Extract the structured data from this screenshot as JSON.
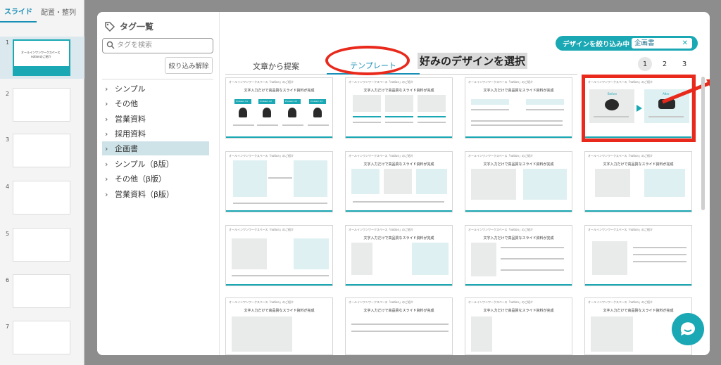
{
  "sidebar_tabs": {
    "slide": "スライド",
    "layout": "配置・整列"
  },
  "slides": [
    "1",
    "2",
    "3",
    "4",
    "5",
    "6",
    "7"
  ],
  "thumb1": {
    "line1": "オールインワンワークスペース",
    "line2": "notionのご紹介"
  },
  "taglist": {
    "title": "タグ一覧",
    "search_placeholder": "タグを検索",
    "filter_clear": "絞り込み解除",
    "categories": [
      "シンプル",
      "その他",
      "営業資料",
      "採用資料",
      "企画書",
      "シンプル（β版）",
      "その他（β版）",
      "営業資料（β版）"
    ]
  },
  "tabs": {
    "from_text": "文章から提案",
    "template": "テンプレート"
  },
  "annotation": "好みのデザインを選択",
  "design_filter": {
    "label": "デザインを絞り込み中",
    "value": "企画書"
  },
  "pages": [
    "1",
    "2",
    "3"
  ],
  "card": {
    "header": "オールインワンワークスペース「notion」のご紹介",
    "title": "文字入力だけで高品質なスライド資料が完成",
    "problems": [
      "Problem 01",
      "Problem 02",
      "Problem 03",
      "Problem 04"
    ],
    "before": "Before",
    "after": "After"
  },
  "colors": {
    "accent": "#1aa8b4",
    "highlight": "#e8291c"
  }
}
